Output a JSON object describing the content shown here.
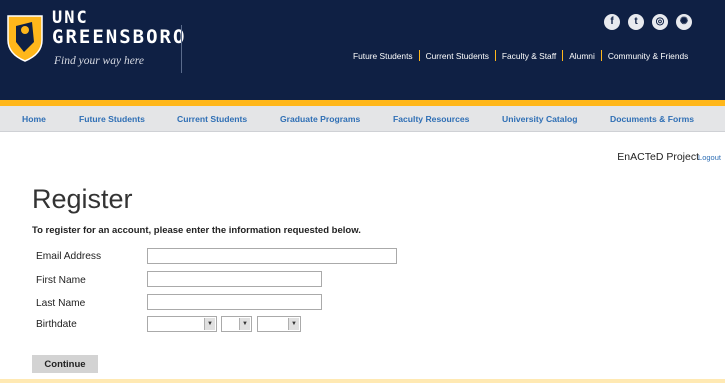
{
  "brand": {
    "line1": "UNC",
    "line2": "GREENSBORO",
    "tagline": "Find your way here"
  },
  "social_icons": [
    "facebook-icon",
    "twitter-icon",
    "instagram-icon",
    "globe-icon"
  ],
  "top_nav": [
    "Future Students",
    "Current Students",
    "Faculty & Staff",
    "Alumni",
    "Community & Friends"
  ],
  "sub_nav": [
    "Home",
    "Future Students",
    "Current Students",
    "Graduate Programs",
    "Faculty Resources",
    "University Catalog",
    "Documents & Forms"
  ],
  "user": {
    "project": "EnACTeD Project",
    "logout": "Logout"
  },
  "page": {
    "title": "Register",
    "intro": "To register for an account, please enter the information requested below."
  },
  "form": {
    "email_label": "Email Address",
    "email_value": "",
    "first_label": "First Name",
    "first_value": "",
    "last_label": "Last Name",
    "last_value": "",
    "birthdate_label": "Birthdate",
    "birth_month": "",
    "birth_day": "",
    "birth_year": "",
    "continue": "Continue"
  },
  "colors": {
    "navy": "#0f2044",
    "gold": "#ffb71b",
    "link_blue": "#2f6fb5"
  }
}
